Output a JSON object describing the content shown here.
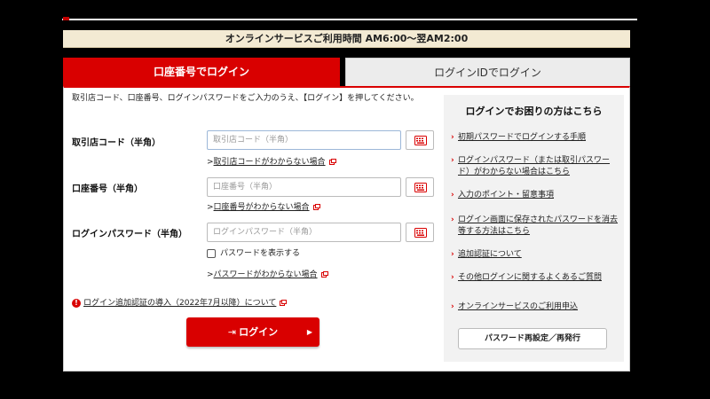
{
  "hours": "オンラインサービスご利用時間 AM6:00～翌AM2:00",
  "tabs": {
    "active": "口座番号でログイン",
    "inactive": "ログインIDでログイン"
  },
  "intro": "取引店コード、口座番号、ログインパスワードをご入力のうえ、【ログイン】を押してください。",
  "fields": {
    "branch": {
      "label": "取引店コード（半角）",
      "placeholder": "取引店コード（半角）",
      "help": "取引店コードがわからない場合"
    },
    "account": {
      "label": "口座番号（半角）",
      "placeholder": "口座番号（半角）",
      "help": "口座番号がわからない場合"
    },
    "password": {
      "label": "ログインパスワード（半角）",
      "placeholder": "ログインパスワード（半角）",
      "show_label": "パスワードを表示する",
      "help": "パスワードがわからない場合"
    }
  },
  "notice": "ログイン追加認証の導入（2022年7月以降）について",
  "login_button": "ログイン",
  "sidebar": {
    "title": "ログインでお困りの方はこちら",
    "items": [
      "初期パスワードでログインする手順",
      "ログインパスワード（または取引パスワード）がわからない場合はこちら",
      "入力のポイント・留意事項",
      "ログイン画面に保存されたパスワードを消去等する方法はこちら",
      "追加認証について",
      "その他ログインに関するよくあるご質問",
      "オンラインサービスのご利用申込"
    ],
    "reset_button": "パスワード再設定／再発行"
  },
  "colors": {
    "accent": "#d90000",
    "hours_bg": "#f3ead3",
    "sidebar_bg": "#f2f2f2"
  }
}
